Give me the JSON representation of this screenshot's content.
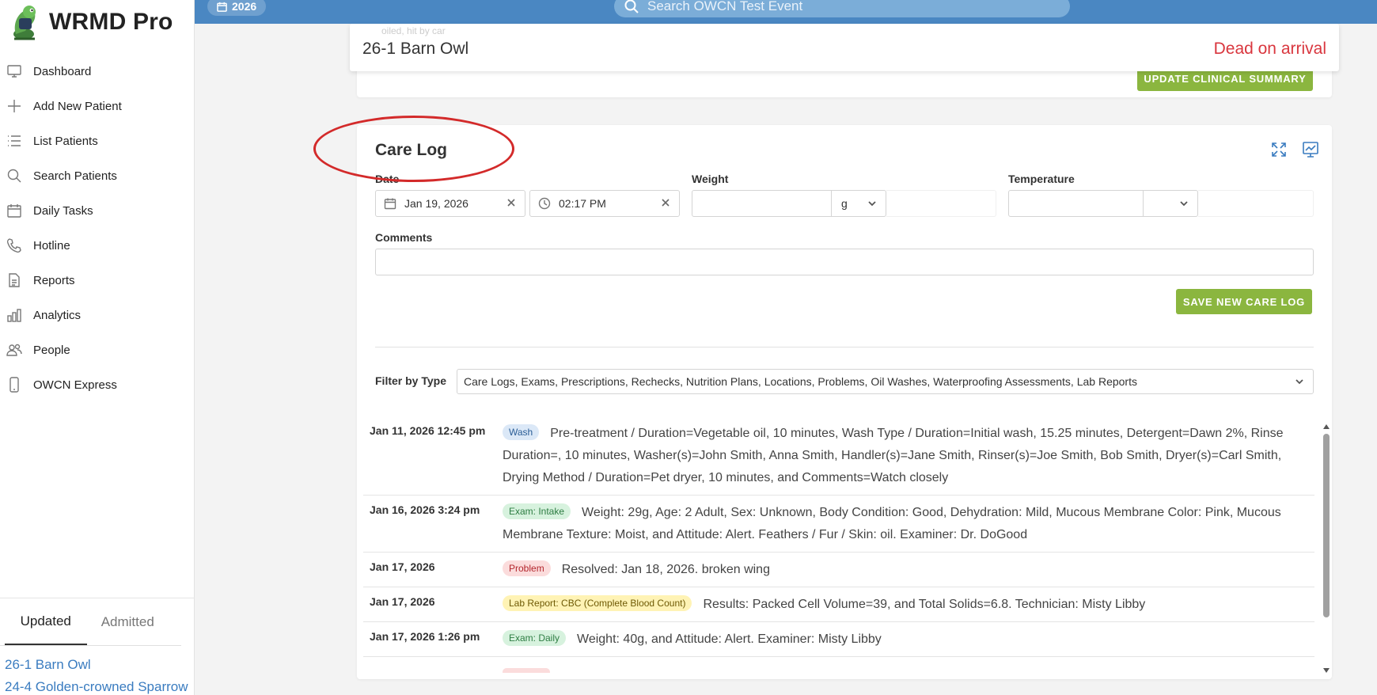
{
  "app": {
    "name": "WRMD Pro"
  },
  "sidebar": {
    "items": [
      {
        "label": "Dashboard",
        "icon": "monitor-icon"
      },
      {
        "label": "Add New Patient",
        "icon": "plus-icon"
      },
      {
        "label": "List Patients",
        "icon": "list-icon"
      },
      {
        "label": "Search Patients",
        "icon": "search-icon"
      },
      {
        "label": "Daily Tasks",
        "icon": "calendar-icon"
      },
      {
        "label": "Hotline",
        "icon": "phone-icon"
      },
      {
        "label": "Reports",
        "icon": "document-icon"
      },
      {
        "label": "Analytics",
        "icon": "bar-chart-icon"
      },
      {
        "label": "People",
        "icon": "people-icon"
      },
      {
        "label": "OWCN Express",
        "icon": "mobile-icon"
      }
    ],
    "recent": {
      "tabs": [
        "Updated",
        "Admitted"
      ],
      "active_tab": "Updated",
      "patients": [
        "26-1 Barn Owl",
        "24-4 Golden-crowned Sparrow"
      ]
    }
  },
  "topbar": {
    "year": "2026",
    "search_placeholder": "Search OWCN Test Event"
  },
  "patient": {
    "ghost_text": "oiled, hit by car",
    "name": "26-1 Barn Owl",
    "status": "Dead on arrival",
    "status_color": "#d9363e"
  },
  "clinical_summary": {
    "button_label": "UPDATE CLINICAL SUMMARY"
  },
  "care_log": {
    "title": "Care Log",
    "form": {
      "date_label": "Date",
      "date_value": "Jan 19, 2026",
      "time_value": "02:17 PM",
      "weight_label": "Weight",
      "weight_value": "",
      "weight_unit": "g",
      "temperature_label": "Temperature",
      "temperature_value": "",
      "temperature_unit": "",
      "comments_label": "Comments",
      "comments_value": "",
      "save_label": "SAVE NEW CARE LOG"
    },
    "filter": {
      "label": "Filter by Type",
      "value": "Care Logs, Exams, Prescriptions, Rechecks, Nutrition Plans, Locations, Problems, Oil Washes, Waterproofing Assessments, Lab Reports"
    },
    "entries": [
      {
        "date": "Jan 11, 2026 12:45 pm",
        "badge": "Wash",
        "badge_color": "blue",
        "text": "Pre-treatment / Duration=Vegetable oil, 10 minutes, Wash Type / Duration=Initial wash, 15.25 minutes, Detergent=Dawn 2%, Rinse Duration=, 10 minutes, Washer(s)=John Smith, Anna Smith, Handler(s)=Jane Smith, Rinser(s)=Joe Smith, Bob Smith, Dryer(s)=Carl Smith, Drying Method / Duration=Pet dryer, 10 minutes, and Comments=Watch closely"
      },
      {
        "date": "Jan 16, 2026 3:24 pm",
        "badge": "Exam: Intake",
        "badge_color": "green",
        "text": "Weight: 29g, Age: 2 Adult, Sex: Unknown, Body Condition: Good, Dehydration: Mild, Mucous Membrane Color: Pink, Mucous Membrane Texture: Moist, and Attitude: Alert. Feathers / Fur / Skin: oil. Examiner: Dr. DoGood"
      },
      {
        "date": "Jan 17, 2026",
        "badge": "Problem",
        "badge_color": "red",
        "text": "Resolved: Jan 18, 2026. broken wing"
      },
      {
        "date": "Jan 17, 2026",
        "badge": "Lab Report: CBC (Complete Blood Count)",
        "badge_color": "yellow",
        "text": "Results: Packed Cell Volume=39, and Total Solids=6.8. Technician: Misty Libby"
      },
      {
        "date": "Jan 17, 2026 1:26 pm",
        "badge": "Exam: Daily",
        "badge_color": "green",
        "text": "Weight: 40g, and Attitude: Alert. Examiner: Misty Libby"
      },
      {
        "date": "",
        "badge": "",
        "badge_color": "red",
        "text": ""
      }
    ]
  },
  "colors": {
    "accent": "#8bb63f",
    "topbar": "#4a87c2",
    "link": "#3a7cc0",
    "annotation": "#d32a2a"
  }
}
